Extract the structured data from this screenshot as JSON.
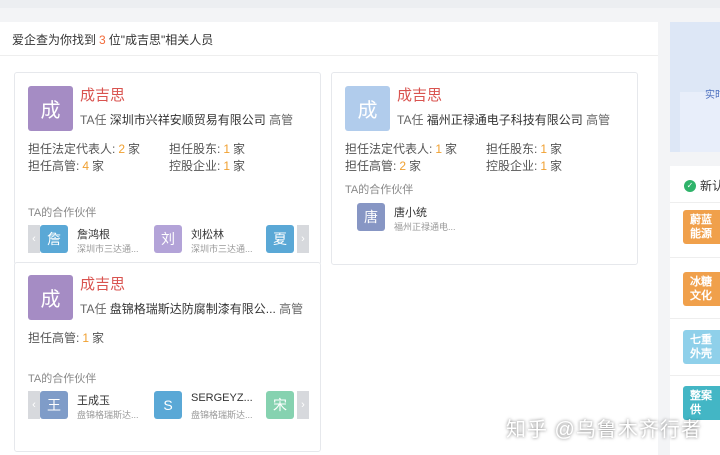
{
  "summary": {
    "prefix": "爱企查为你找到",
    "count": "3",
    "suffix": "位\"成吉思\"相关人员"
  },
  "cards": [
    {
      "avatar": "成",
      "avatar_color": "#a58cc4",
      "name": "成吉思",
      "role_prefix": "TA任",
      "company": "深圳市兴祥安顺贸易有限公司",
      "role_suffix": "高管",
      "stats": [
        {
          "label": "担任法定代表人:",
          "value": "2",
          "unit": "家"
        },
        {
          "label": "担任股东:",
          "value": "1",
          "unit": "家"
        },
        {
          "label": "担任高管:",
          "value": "4",
          "unit": "家"
        },
        {
          "label": "控股企业:",
          "value": "1",
          "unit": "家"
        }
      ],
      "partners_title": "TA的合作伙伴",
      "partners": [
        {
          "avatar": "詹",
          "color": "#5aa8d6",
          "name": "詹鸿根",
          "company": "深圳市三达通..."
        },
        {
          "avatar": "刘",
          "color": "#b3a3d8",
          "name": "刘松林",
          "company": "深圳市三达通..."
        },
        {
          "avatar": "夏",
          "color": "#5aa8d6",
          "name": "",
          "company": ""
        }
      ]
    },
    {
      "avatar": "成",
      "avatar_color": "#b1ccec",
      "name": "成吉思",
      "role_prefix": "TA任",
      "company": "福州正禄通电子科技有限公司",
      "role_suffix": "高管",
      "stats": [
        {
          "label": "担任法定代表人:",
          "value": "1",
          "unit": "家"
        },
        {
          "label": "担任股东:",
          "value": "1",
          "unit": "家"
        },
        {
          "label": "担任高管:",
          "value": "2",
          "unit": "家"
        },
        {
          "label": "控股企业:",
          "value": "1",
          "unit": "家"
        }
      ],
      "partners_title": "TA的合作伙伴",
      "partners": [
        {
          "avatar": "唐",
          "color": "#8796c4",
          "name": "唐小统",
          "company": "福州正禄通电..."
        }
      ]
    },
    {
      "avatar": "成",
      "avatar_color": "#a58cc4",
      "name": "成吉思",
      "role_prefix": "TA任",
      "company": "盘锦格瑞斯达防腐制漆有限公...",
      "role_suffix": "高管",
      "stats": [
        {
          "label": "担任高管:",
          "value": "1",
          "unit": "家"
        }
      ],
      "partners_title": "TA的合作伙伴",
      "partners": [
        {
          "avatar": "王",
          "color": "#7f9cc8",
          "name": "王成玉",
          "company": "盘锦格瑞斯达..."
        },
        {
          "avatar": "S",
          "color": "#5aa8d6",
          "name": "SERGEYZ...",
          "company": "盘锦格瑞斯达..."
        },
        {
          "avatar": "宋",
          "color": "#86d2b0",
          "name": "",
          "company": ""
        }
      ]
    }
  ],
  "arrows": {
    "left": "‹",
    "right": "›"
  },
  "right_ad": {
    "text": "实时"
  },
  "new_box": {
    "title": "新认",
    "tiles": [
      {
        "line1": "蔚蓝",
        "line2": "能源",
        "color": "#f0a04b"
      },
      {
        "line1": "冰糖",
        "line2": "文化",
        "color": "#f0a04b"
      },
      {
        "line1": "七重",
        "line2": "外壳",
        "color": "#8fd0ea"
      },
      {
        "line1": "整案",
        "line2": "供",
        "color": "#43b6c5"
      }
    ]
  },
  "watermark": "知乎 @乌鲁木齐行者"
}
